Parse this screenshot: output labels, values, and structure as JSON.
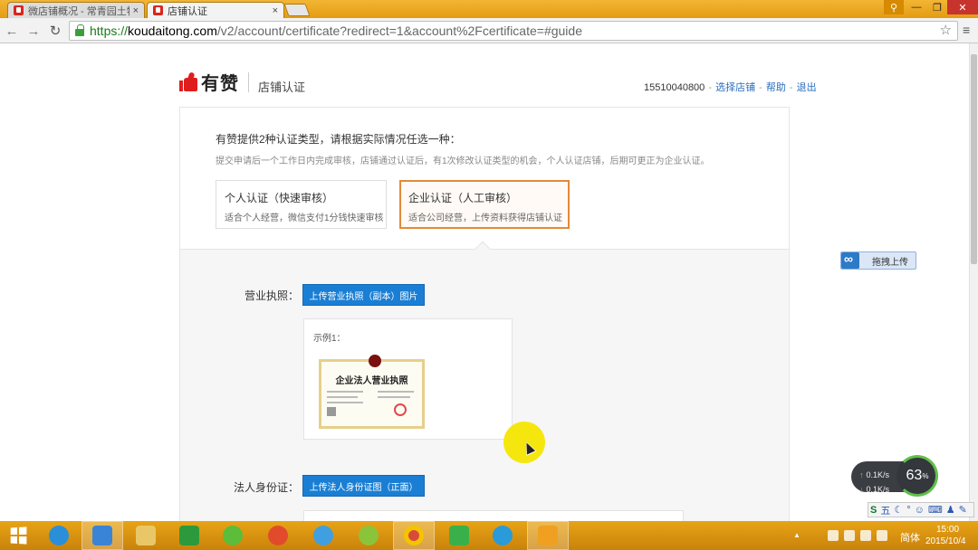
{
  "browser": {
    "tabs": [
      {
        "title": "微店铺概况 - 常青园土特产",
        "active": false
      },
      {
        "title": "店铺认证",
        "active": true
      }
    ],
    "tab_close_glyph": "×",
    "url": {
      "scheme": "https://",
      "host": "koudaitong.com",
      "rest": "/v2/account/certificate?redirect=1&account%2Fcertificate=#guide"
    }
  },
  "header": {
    "brand": "有赞",
    "page_title": "店铺认证",
    "account": "15510040800",
    "sep1": " - ",
    "switch_shop": "选择店铺",
    "sep2": " - ",
    "help": "帮助",
    "sep3": " - ",
    "logout": "退出"
  },
  "intro": {
    "title": "有赞提供2种认证类型，请根据实际情况任选一种：",
    "desc": "提交申请后一个工作日内完成审核，店铺通过认证后，有1次修改认证类型的机会，个人认证店铺，后期可更正为企业认证。"
  },
  "options": [
    {
      "title": "个人认证（快速审核）",
      "desc": "适合个人经营，微信支付1分钱快速审核",
      "selected": false
    },
    {
      "title": "企业认证（人工审核）",
      "desc": "适合公司经营，上传资料获得店铺认证",
      "selected": true
    }
  ],
  "form": {
    "license_label": "营业执照：",
    "license_button": "上传营业执照（副本）图片",
    "sample_caption": "示例1：",
    "sample_cert_title": "企业法人营业执照",
    "idcard_label": "法人身份证：",
    "idcard_button": "上传法人身份证图（正面）"
  },
  "widgets": {
    "drag_upload": "拖拽上传",
    "net_up": "0.1K/s",
    "net_down": "0.1K/s",
    "net_percent": "63",
    "net_percent_unit": "%",
    "ime": "五"
  },
  "taskbar": {
    "lang": "简体",
    "time": "15:00",
    "date": "2015/10/4"
  },
  "colors": {
    "accent_blue": "#1a7fd4",
    "selected_border": "#e28a3a",
    "brand_red": "#e01d1d",
    "taskbar": "#d6900f"
  }
}
